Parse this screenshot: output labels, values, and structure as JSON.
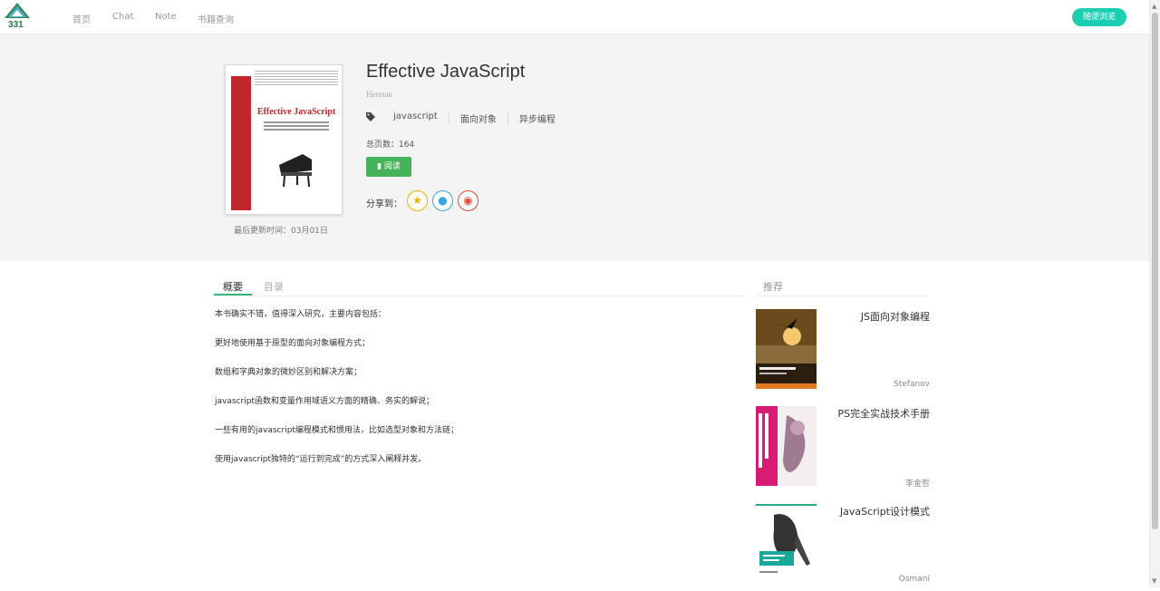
{
  "nav": {
    "logo_num": "331",
    "links": [
      "首页",
      "Chat",
      "Note",
      "书籍查询"
    ],
    "button": "随便浏览"
  },
  "book": {
    "title": "Effective JavaScript",
    "author": "Herman",
    "tags": [
      "javascript",
      "面向对象",
      "异步编程"
    ],
    "pages": "总页数：164",
    "read_label": "阅读",
    "share_label": "分享到：",
    "update_time": "最后更新时间：03月01日",
    "cover_title": "Effective JavaScript",
    "cover_color": "#c1272d"
  },
  "tabs": {
    "active": "概要",
    "other": "目录"
  },
  "summary": [
    "本书确实不错，值得深入研究，主要内容包括：",
    "更好地使用基于原型的面向对象编程方式；",
    "数组和字典对象的微妙区别和解决方案；",
    "javascript函数和变量作用域语义方面的精确、务实的解说；",
    "一些有用的javascript编程模式和惯用法，比如选型对象和方法链；",
    "使用javascript独特的“运行到完成”的方式深入阐释并发。"
  ],
  "recommend": {
    "label": "推荐",
    "items": [
      {
        "title": "JS面向对象编程",
        "author": "Stefanov"
      },
      {
        "title": "PS完全实战技术手册",
        "author": "李金哲"
      },
      {
        "title": "JavaScript设计模式",
        "author": "Osmani"
      }
    ]
  },
  "colors": {
    "accent": "#1ccfb3",
    "read_button": "#46b35a",
    "tab_active": "#3ab57a"
  }
}
